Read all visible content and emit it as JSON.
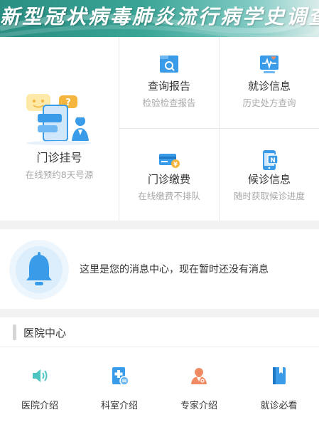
{
  "banner": {
    "title": "新型冠状病毒肺炎流行病学史调查表"
  },
  "services": {
    "registration": {
      "label": "门诊挂号",
      "sub": "在线预约8天号源"
    },
    "report": {
      "label": "查询报告",
      "sub": "检验检查报告"
    },
    "visit_info": {
      "label": "就诊信息",
      "sub": "历史处方查询"
    },
    "payment": {
      "label": "门诊缴费",
      "sub": "在线缴费不排队"
    },
    "queue": {
      "label": "候诊信息",
      "sub": "随时获取候诊进度"
    }
  },
  "messages": {
    "text": "这里是您的消息中心，现在暂时还没有消息"
  },
  "hospital_center": {
    "title": "医院中心",
    "items": [
      {
        "label": "医院介绍",
        "icon": "speaker-icon",
        "color": "#4cc4c0"
      },
      {
        "label": "科室介绍",
        "icon": "department-icon",
        "color": "#3a9be8"
      },
      {
        "label": "专家介绍",
        "icon": "expert-icon",
        "color": "#f08a62"
      },
      {
        "label": "就诊必看",
        "icon": "book-icon",
        "color": "#3a9be8"
      }
    ]
  },
  "colors": {
    "primary_blue": "#3a9be8",
    "accent_yellow": "#f4b63e",
    "banner_teal": "#3aa596"
  }
}
